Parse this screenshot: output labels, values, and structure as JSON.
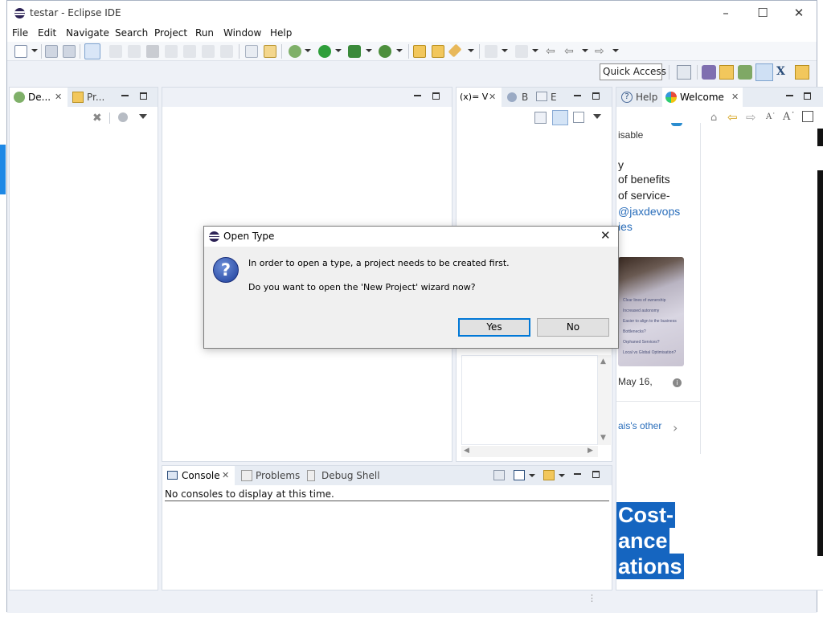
{
  "window": {
    "title": "testar - Eclipse IDE"
  },
  "menu": [
    "File",
    "Edit",
    "Navigate",
    "Search",
    "Project",
    "Run",
    "Window",
    "Help"
  ],
  "quick_access": {
    "label": "Quick Access"
  },
  "debug_panel": {
    "tabs": [
      {
        "label": "De..."
      },
      {
        "label": "Pr..."
      }
    ]
  },
  "variables_panel": {
    "tabs": [
      {
        "label": "(x)= V"
      },
      {
        "label": "B"
      },
      {
        "label": "E"
      }
    ]
  },
  "help_panel": {
    "tabs": [
      {
        "label": "Help"
      },
      {
        "label": "Welcome"
      }
    ],
    "welcome": {
      "lines": [
        "isable",
        "y",
        "of benefits",
        "of service-"
      ],
      "links": [
        "@jaxdevops",
        "ies"
      ],
      "image_caption_lines": [
        "Clear lines of ownership",
        "Increased autonomy",
        "Easier to align to the business",
        "Bottlenecks?",
        "Orphaned Services?",
        "Local vs Global Optimisation?"
      ],
      "date": "May 16,",
      "other_link": "ais's other",
      "headline": [
        "Cost-",
        "ance",
        "ations"
      ]
    }
  },
  "console_panel": {
    "tabs": [
      {
        "label": "Console"
      },
      {
        "label": "Problems"
      },
      {
        "label": "Debug Shell"
      }
    ],
    "message": "No consoles to display at this time."
  },
  "dialog": {
    "title": "Open Type",
    "message": "In order to open a type, a project needs to be created first.",
    "question": "Do you want to open the 'New Project' wizard now?",
    "yes_label": "Yes",
    "no_label": "No"
  },
  "colors": {
    "accent": "#0078d7",
    "headline_bg": "#1565c0",
    "link": "#2a6ebb"
  }
}
